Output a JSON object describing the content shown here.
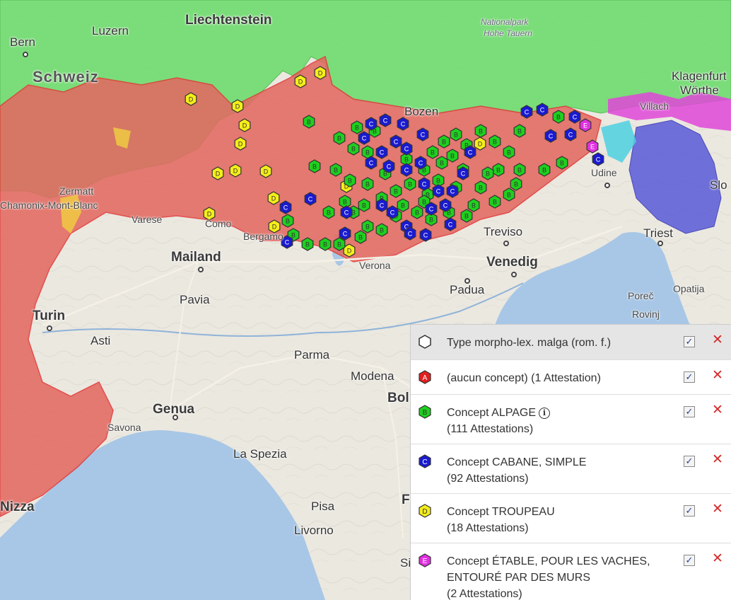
{
  "map": {
    "colors": {
      "land": "#ebe8e0",
      "water": "#a8c7e6",
      "green_region": "#6edc6e",
      "red_region": "#e26a62",
      "blue_region": "#5a5ad8",
      "magenta_region": "#e046d8",
      "cyan_region": "#4ed0e0",
      "yellow_region": "#f0d040"
    },
    "places": {
      "bern": "Bern",
      "luzern": "Luzern",
      "liechtenstein": "Liechtenstein",
      "schweiz": "Schweiz",
      "nationalpark": "Nationalpark",
      "hohe_tauern": "Hohe Tauern",
      "klagenfurt": "Klagenfurt",
      "worthe": "Wörthe",
      "villach": "Villach",
      "bozen": "Bozen",
      "zermatt": "Zermatt",
      "chamonix": "Chamonix-Mont-Blanc",
      "varese": "Varese",
      "como": "Como",
      "bergamo": "Bergamo",
      "udine": "Udine",
      "slo": "Slo",
      "triest": "Triest",
      "treviso": "Treviso",
      "mailand": "Mailand",
      "venedig": "Venedig",
      "verona": "Verona",
      "padua": "Padua",
      "pavia": "Pavia",
      "turin": "Turin",
      "asti": "Asti",
      "parma": "Parma",
      "modena": "Modena",
      "bologna": "Bol",
      "genua": "Genua",
      "savona": "Savona",
      "la_spezia": "La Spezia",
      "pisa": "Pisa",
      "livorno": "Livorno",
      "florenz": "Flor",
      "siena": "Si",
      "porec": "Poreč",
      "rovinj": "Rovinj",
      "opatija": "Opatija",
      "nizza": "Nizza"
    }
  },
  "markers": {
    "A": {
      "letter": "A",
      "color": "#e02020"
    },
    "B": {
      "letter": "B",
      "color": "#1ed01e"
    },
    "C": {
      "letter": "C",
      "color": "#1a1ad0"
    },
    "D": {
      "letter": "D",
      "color": "#f4ee1a"
    },
    "E": {
      "letter": "E",
      "color": "#e030e0"
    }
  },
  "legend": {
    "header": {
      "label": "Type morpho-lex. malga (rom. f.)",
      "checked": "✓",
      "remove": "✕"
    },
    "items": [
      {
        "line1": "(aucun concept) (1 Attestation)",
        "line2": "",
        "checked": "✓",
        "remove": "✕"
      },
      {
        "line1": "Concept ALPAGE",
        "info": "i",
        "line2": "(111 Attestations)",
        "checked": "✓",
        "remove": "✕"
      },
      {
        "line1": "Concept CABANE, SIMPLE",
        "line2": "(92 Attestations)",
        "checked": "✓",
        "remove": "✕"
      },
      {
        "line1": "Concept TROUPEAU",
        "line2": "(18 Attestations)",
        "checked": "✓",
        "remove": "✕"
      },
      {
        "line1": "Concept ÉTABLE, POUR LES VACHES,",
        "line2": "ENTOURÉ PAR DES MURS",
        "line3": "(2 Attestations)",
        "checked": "✓",
        "remove": "✕"
      }
    ]
  }
}
